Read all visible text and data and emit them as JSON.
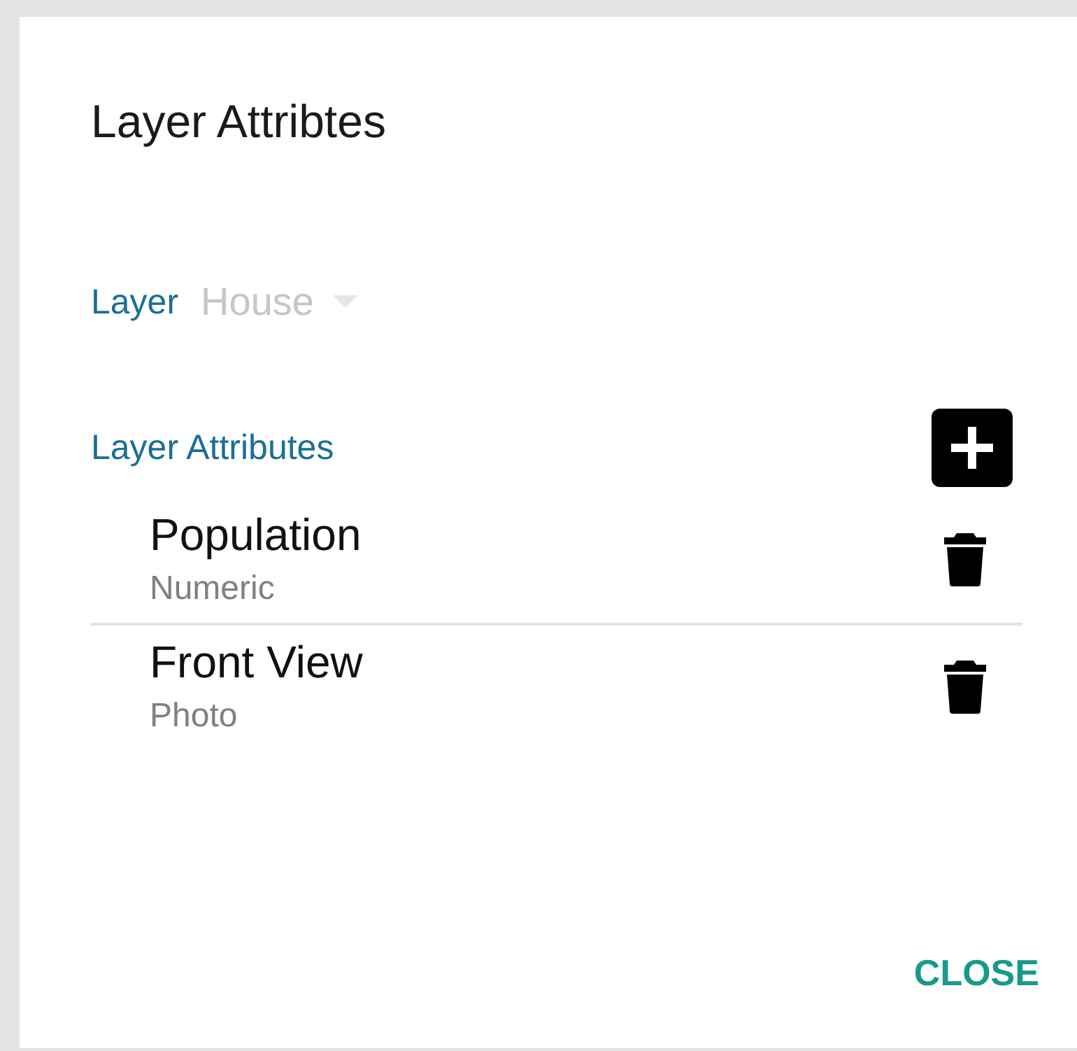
{
  "dialog": {
    "title": "Layer Attribtes"
  },
  "layer_field": {
    "label": "Layer",
    "value": "House",
    "disabled": true
  },
  "attributes": {
    "label": "Layer Attributes",
    "items": [
      {
        "name": "Population",
        "type": "Numeric"
      },
      {
        "name": "Front View",
        "type": "Photo"
      }
    ]
  },
  "buttons": [
    {
      "label": "CLOSE"
    }
  ]
}
